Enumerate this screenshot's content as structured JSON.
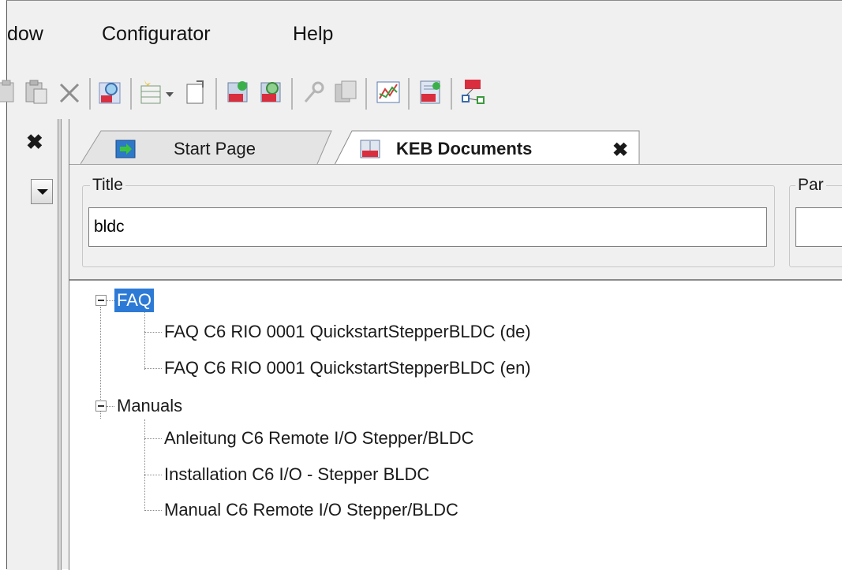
{
  "menu": {
    "items": [
      "dow",
      "Configurator",
      "Help"
    ]
  },
  "toolbar": {
    "icons": [
      "paste-icon",
      "copy-icon",
      "delete-icon",
      "search-keb-icon",
      "new-project-icon",
      "export-icon",
      "keb-add-icon",
      "keb-search-icon",
      "key-icon",
      "copy-document-icon",
      "chart-icon",
      "keb-doc-icon",
      "network-icon"
    ]
  },
  "left_panel": {
    "close_label": "✖"
  },
  "tabs": [
    {
      "label": "Start Page",
      "icon": "start-page-icon",
      "active": false
    },
    {
      "label": "KEB Documents",
      "icon": "keb-documents-icon",
      "active": true,
      "close": "✖"
    }
  ],
  "filters": {
    "title": {
      "label": "Title",
      "value": "bldc"
    },
    "par": {
      "label": "Par"
    }
  },
  "tree": {
    "groups": [
      {
        "label": "FAQ",
        "selected": true,
        "children": [
          "FAQ C6 RIO 0001 QuickstartStepperBLDC (de)",
          "FAQ C6 RIO 0001 QuickstartStepperBLDC (en)"
        ]
      },
      {
        "label": "Manuals",
        "selected": false,
        "children": [
          "Anleitung C6 Remote I/O Stepper/BLDC",
          "Installation C6 I/O - Stepper BLDC",
          "Manual C6 Remote I/O Stepper/BLDC"
        ]
      }
    ]
  },
  "colors": {
    "selection": "#2d7ad6",
    "background": "#f0f0f0"
  }
}
